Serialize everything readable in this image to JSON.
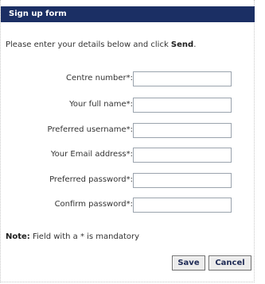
{
  "form": {
    "title": "Sign up form",
    "intro_text": "Please enter your details below and click ",
    "intro_emphasis": "Send",
    "intro_end": ".",
    "fields": [
      {
        "label": "Centre number*:",
        "value": ""
      },
      {
        "label": "Your full name*:",
        "value": ""
      },
      {
        "label": "Preferred username*:",
        "value": ""
      },
      {
        "label": "Your Email address*:",
        "value": ""
      },
      {
        "label": "Preferred password*:",
        "value": ""
      },
      {
        "label": "Confirm password*:",
        "value": ""
      }
    ],
    "note_label": "Note:",
    "note_text": " Field with a * is mandatory",
    "save_label": "Save",
    "cancel_label": "Cancel"
  },
  "colors": {
    "title_bar_bg": "#1b2f64",
    "title_text": "#ffffff"
  }
}
